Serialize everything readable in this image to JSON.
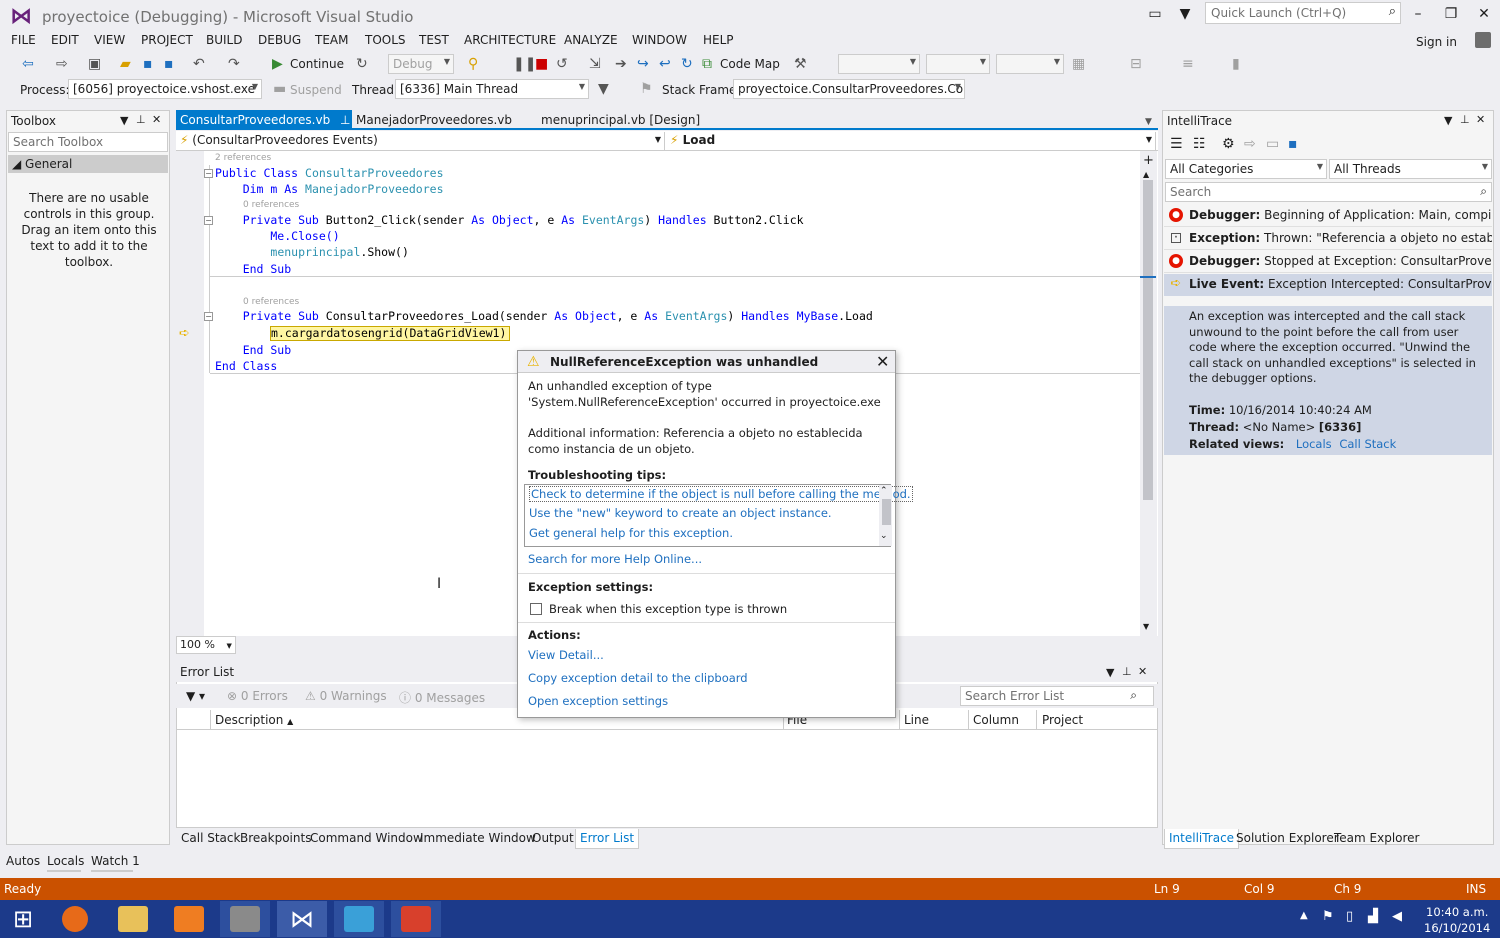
{
  "window": {
    "title": "proyectoice (Debugging) - Microsoft Visual Studio",
    "quick_launch": "Quick Launch (Ctrl+Q)",
    "sign_in": "Sign in"
  },
  "menu": [
    "FILE",
    "EDIT",
    "VIEW",
    "PROJECT",
    "BUILD",
    "DEBUG",
    "TEAM",
    "TOOLS",
    "TEST",
    "ARCHITECTURE",
    "ANALYZE",
    "WINDOW",
    "HELP"
  ],
  "toolbar": {
    "continue": "Continue",
    "config": "Debug",
    "code_map": "Code Map"
  },
  "debug_location": {
    "process_label": "Process:",
    "process": "[6056] proyectoice.vshost.exe",
    "suspend": "Suspend",
    "thread_label": "Thread:",
    "thread": "[6336] Main Thread",
    "stack_label": "Stack Frame:",
    "stack": "proyectoice.ConsultarProveedores.Consult"
  },
  "toolbox": {
    "title": "Toolbox",
    "search": "Search Toolbox",
    "group": "General",
    "empty": "There are no usable controls in this group. Drag an item onto this text to add it to the toolbox."
  },
  "tabs": [
    {
      "label": "ConsultarProveedores.vb"
    },
    {
      "label": "ManejadorProveedores.vb"
    },
    {
      "label": "menuprincipal.vb [Design]"
    }
  ],
  "nav": {
    "left": "(ConsultarProveedores Events)",
    "right": "Load"
  },
  "code": {
    "ref2": "2 references",
    "ref0a": "0 references",
    "ref0b": "0 references",
    "l1a": "Public Class ",
    "l1b": "ConsultarProveedores",
    "l2a": "    Dim m As ",
    "l2b": "ManejadorProveedores",
    "l3a": "    Private Sub ",
    "l3b": "Button2_Click(sender ",
    "l3c": "As Object",
    "l3d": ", e ",
    "l3e": "As ",
    "l3f": "EventArgs",
    "l3g": ") ",
    "l3h": "Handles",
    "l3i": " Button2.Click",
    "l4": "        Me.Close()",
    "l5a": "        ",
    "l5b": "menuprincipal",
    "l5c": ".Show()",
    "l6": "    End Sub",
    "l7a": "    Private Sub ",
    "l7b": "ConsultarProveedores_Load(sender ",
    "l7c": "As Object",
    "l7d": ", e ",
    "l7e": "As ",
    "l7f": "EventArgs",
    "l7g": ") ",
    "l7h": "Handles MyBase",
    "l7i": ".Load",
    "l8": "m.cargardatosengrid(DataGridView1)",
    "l9": "    End Sub",
    "l10": "End Class"
  },
  "zoom": "100 %",
  "exception": {
    "title": "NullReferenceException was unhandled",
    "desc": "An unhandled exception of type 'System.NullReferenceException' occurred in proyectoice.exe",
    "info": "Additional information: Referencia a objeto no establecida como instancia de un objeto.",
    "tips_title": "Troubleshooting tips:",
    "tips": [
      "Check to determine if the object is null before calling the method.",
      "Use the \"new\" keyword to create an object instance.",
      "Get general help for this exception."
    ],
    "search_online": "Search for more Help Online...",
    "settings_title": "Exception settings:",
    "break_label": "Break when this exception type is thrown",
    "actions_title": "Actions:",
    "actions": [
      "View Detail...",
      "Copy exception detail to the clipboard",
      "Open exception settings"
    ]
  },
  "error_list": {
    "title": "Error List",
    "errors": "0 Errors",
    "warnings": "0 Warnings",
    "messages": "0 Messages",
    "search": "Search Error List",
    "columns": [
      "Description",
      "File",
      "Line",
      "Column",
      "Project"
    ]
  },
  "bottom_tabs": [
    "Call Stack",
    "Breakpoints",
    "Command Window",
    "Immediate Window",
    "Output",
    "Error List"
  ],
  "left_tabs": [
    "Autos",
    "Locals",
    "Watch 1"
  ],
  "intellitrace": {
    "title": "IntelliTrace",
    "categories": "All Categories",
    "threads": "All Threads",
    "search": "Search",
    "events": [
      {
        "bold": "Debugger:",
        "text": " Beginning of Application: Main, compiler"
      },
      {
        "bold": "Exception:",
        "text": " Thrown: \"Referencia a objeto no establec"
      },
      {
        "bold": "Debugger:",
        "text": " Stopped at Exception: ConsultarProveedo"
      },
      {
        "bold": "Live Event:",
        "text": " Exception Intercepted: ConsultarProveed"
      }
    ],
    "detail": "An exception was intercepted and the call stack unwound to the point before the call from user code where the exception occurred.  \"Unwind the call stack on unhandled exceptions\" is selected in the debugger options.",
    "time_label": "Time:",
    "time": "10/16/2014 10:40:24 AM",
    "thread_label": "Thread:",
    "thread": "<No Name>",
    "thread_id": "[6336]",
    "views_label": "Related views:",
    "views": [
      "Locals",
      "Call Stack"
    ]
  },
  "right_tabs": [
    "IntelliTrace",
    "Solution Explorer",
    "Team Explorer"
  ],
  "status": {
    "ready": "Ready",
    "ln": "Ln 9",
    "col": "Col 9",
    "ch": "Ch 9",
    "ins": "INS"
  },
  "clock": {
    "time": "10:40 a.m.",
    "date": "16/10/2014"
  }
}
